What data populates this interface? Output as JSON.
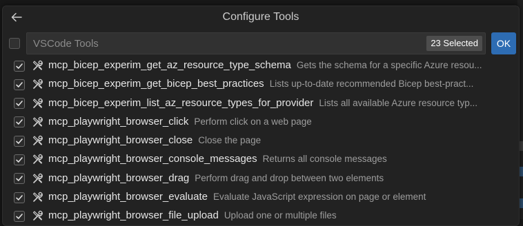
{
  "header": {
    "title": "Configure Tools",
    "back_icon": "arrow-left-icon"
  },
  "filter": {
    "placeholder": "VSCode Tools",
    "value": "",
    "count_badge": "23 Selected",
    "ok_label": "OK",
    "select_all_checked": false
  },
  "colors": {
    "accent": "#2d6cb3",
    "background": "#222222",
    "description": "#9d9d9d"
  },
  "tools": [
    {
      "name": "mcp_bicep_experim_get_az_resource_type_schema",
      "description": "Gets the schema for a specific Azure resou...",
      "checked": true
    },
    {
      "name": "mcp_bicep_experim_get_bicep_best_practices",
      "description": "Lists up-to-date recommended Bicep best-pract...",
      "checked": true
    },
    {
      "name": "mcp_bicep_experim_list_az_resource_types_for_provider",
      "description": "Lists all available Azure resource typ...",
      "checked": true
    },
    {
      "name": "mcp_playwright_browser_click",
      "description": "Perform click on a web page",
      "checked": true
    },
    {
      "name": "mcp_playwright_browser_close",
      "description": "Close the page",
      "checked": true
    },
    {
      "name": "mcp_playwright_browser_console_messages",
      "description": "Returns all console messages",
      "checked": true
    },
    {
      "name": "mcp_playwright_browser_drag",
      "description": "Perform drag and drop between two elements",
      "checked": true
    },
    {
      "name": "mcp_playwright_browser_evaluate",
      "description": "Evaluate JavaScript expression on page or element",
      "checked": true
    },
    {
      "name": "mcp_playwright_browser_file_upload",
      "description": "Upload one or multiple files",
      "checked": true
    }
  ]
}
